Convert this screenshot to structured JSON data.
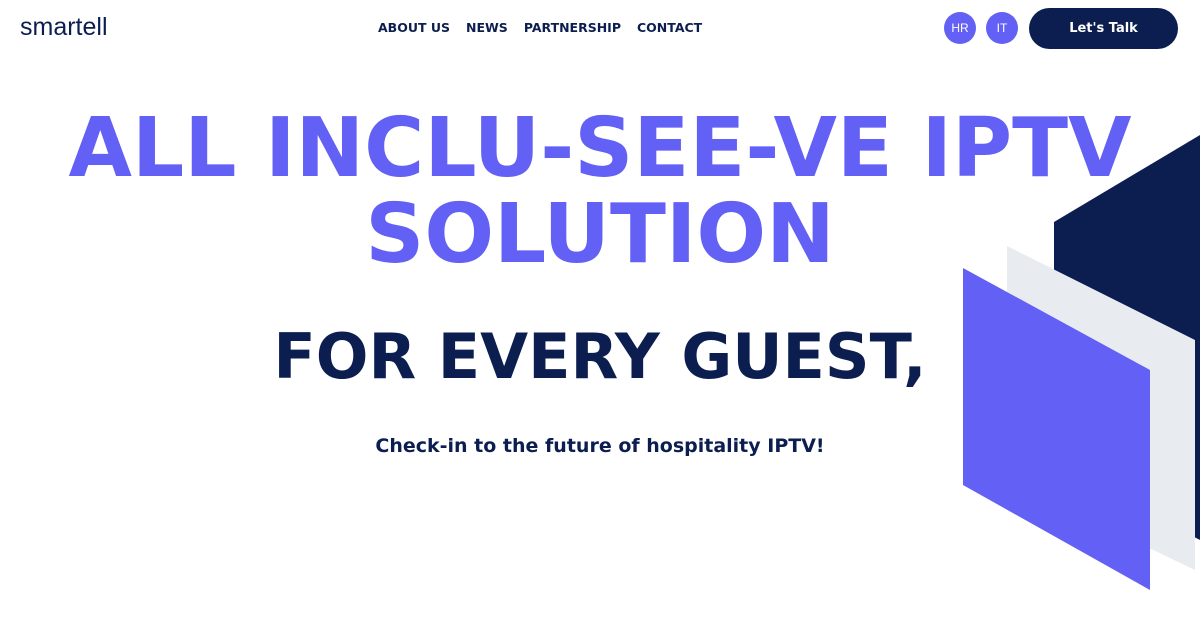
{
  "header": {
    "logo_text": "smartell",
    "nav": [
      {
        "label": "ABOUT US"
      },
      {
        "label": "NEWS"
      },
      {
        "label": "PARTNERSHIP"
      },
      {
        "label": "CONTACT"
      }
    ],
    "languages": [
      {
        "label": "HR"
      },
      {
        "label": "IT"
      }
    ],
    "cta_label": "Let's Talk"
  },
  "hero": {
    "headline_line1": "ALL INCLU-SEE-VE IPTV",
    "headline_line2": "SOLUTION",
    "subheadline": "FOR EVERY GUEST,",
    "tagline": "Check-in to the future of hospitality IPTV!"
  },
  "colors": {
    "accent": "#6260f5",
    "navy": "#0b1e4f",
    "light_gray": "#e8ecf0",
    "background": "#ffffff"
  }
}
